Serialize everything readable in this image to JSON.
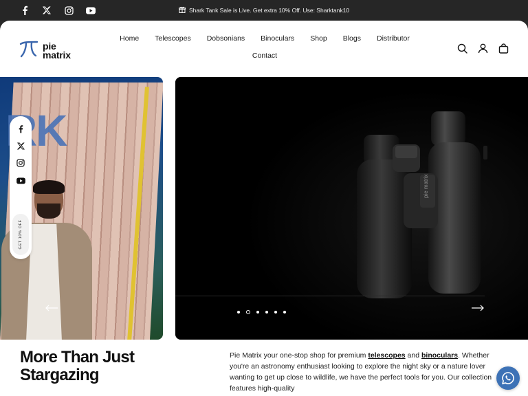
{
  "announcement": {
    "text": "Shark Tank Sale is Live. Get extra 10% Off. Use: Sharktank10",
    "icon": "gift-icon"
  },
  "top_social": [
    "facebook-icon",
    "x-icon",
    "instagram-icon",
    "youtube-icon"
  ],
  "logo": {
    "line1": "pie",
    "line2": "matrix"
  },
  "nav": {
    "row1": [
      "Home",
      "Telescopes",
      "Dobsonians",
      "Binoculars",
      "Shop",
      "Blogs",
      "Distributor"
    ],
    "row2": [
      "Contact"
    ]
  },
  "header_icons": [
    "search-icon",
    "account-icon",
    "cart-icon"
  ],
  "hero": {
    "left_slide_text": "RK",
    "slides_count": 6,
    "active_slide": 2
  },
  "floating_social": {
    "icons": [
      "facebook-icon",
      "x-icon",
      "instagram-icon",
      "youtube-icon"
    ],
    "promo_label": "GET 10% OFF"
  },
  "intro": {
    "heading_line1": "More Than Just",
    "heading_line2": "Stargazing",
    "paragraph_before_link1": "Pie Matrix your one-stop shop for premium ",
    "link1": "telescopes",
    "paragraph_between": " and ",
    "link2": "binoculars",
    "paragraph_after": ". Whether you're an astronomy enthusiast looking to explore the night sky or a nature lover wanting to get up close to wildlife, we have the perfect tools for you. Our collection features high-quality"
  },
  "colors": {
    "topbar": "#262626",
    "whatsapp": "#3d72b6",
    "brand_blue": "#4a73b7"
  }
}
